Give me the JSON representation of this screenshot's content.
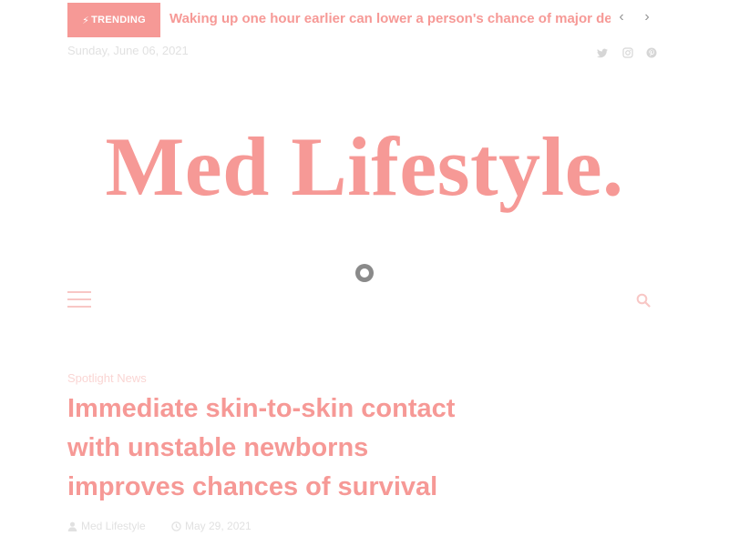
{
  "topbar": {
    "trending_label": "TRENDING",
    "ticker_text": "Waking up one hour earlier can lower a person's chance of major depression",
    "date": "Sunday, June 06, 2021",
    "social": [
      "twitter-icon",
      "instagram-icon",
      "pinterest-icon"
    ]
  },
  "site": {
    "logo": "Med Lifestyle."
  },
  "article": {
    "category": "Spotlight News",
    "title": "Immediate skin-to-skin contact with unstable newborns improves chances of survival",
    "author": "Med Lifestyle",
    "date": "May 29, 2021"
  },
  "colors": {
    "accent": "#f25b56",
    "text_muted": "#cfcfcf"
  }
}
